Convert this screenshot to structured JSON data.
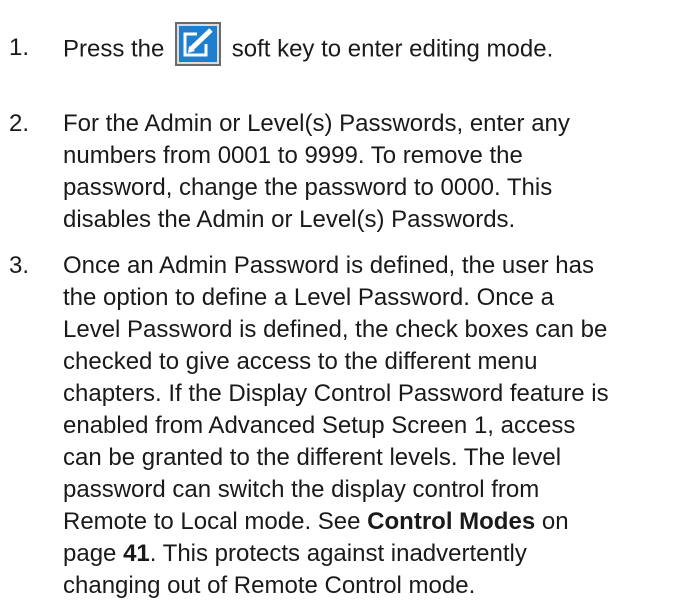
{
  "steps": [
    {
      "number": "1.",
      "text_before_icon": "Press the",
      "icon": "edit-softkey-icon",
      "text_after_icon": "soft key to enter editing mode."
    },
    {
      "number": "2.",
      "lines": [
        "For the Admin or Level(s) Passwords, enter any",
        "numbers from 0001 to 9999. To remove the",
        "password, change the password to 0000. This",
        "disables the Admin or Level(s) Passwords."
      ]
    },
    {
      "number": "3.",
      "lines": [
        "Once an Admin Password is defined, the user has",
        "the option to define a Level Password. Once a",
        "Level Password is defined, the check boxes can be",
        "checked to give access to the different menu",
        "chapters. If the Display Control Password feature is",
        "enabled from Advanced Setup Screen 1, access",
        "can be granted to the different levels. The level",
        "password can switch the display control from"
      ],
      "line9_before": "Remote to Local mode. See ",
      "line9_bold": "Control Modes",
      "line9_after": " on",
      "line10_before": "page ",
      "line10_bold": "41",
      "line10_after": ". This protects against inadvertently",
      "line11": "changing out of Remote Control mode."
    }
  ],
  "colors": {
    "icon_blue": "#1e7fd0",
    "icon_border": "#6a6a6a",
    "icon_white": "#ffffff"
  }
}
